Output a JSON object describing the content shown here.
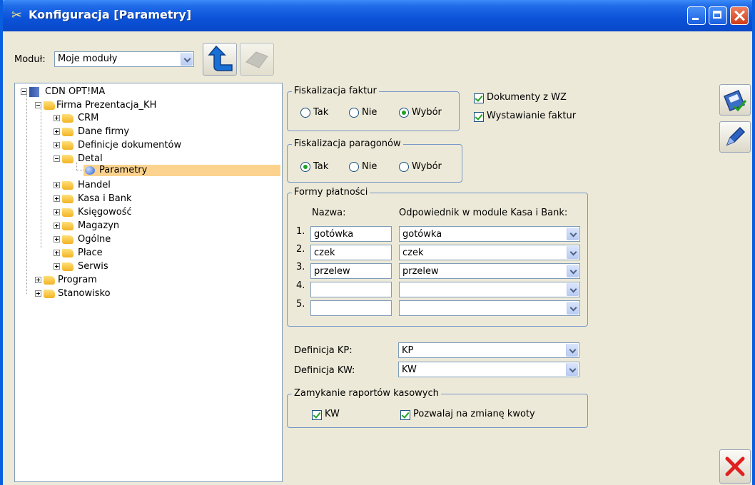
{
  "window": {
    "title": "Konfiguracja [Parametry]"
  },
  "modul": {
    "label": "Moduł:",
    "value": "Moje moduły"
  },
  "tree": {
    "root": "CDN OPT!MA",
    "firma": "Firma Prezentacja_KH",
    "firma_children": [
      "CRM",
      "Dane firmy",
      "Definicje dokumentów",
      "Detal"
    ],
    "detal_child": "Parametry",
    "firma_children_after": [
      "Handel",
      "Kasa i Bank",
      "Księgowość",
      "Magazyn",
      "Ogólne",
      "Płace",
      "Serwis"
    ],
    "top_after": [
      "Program",
      "Stanowisko"
    ]
  },
  "fisk_faktur": {
    "legend": "Fiskalizacja faktur",
    "options": [
      "Tak",
      "Nie",
      "Wybór"
    ],
    "selected": "Wybór"
  },
  "checks_top": [
    {
      "label": "Dokumenty z WZ",
      "checked": true
    },
    {
      "label": "Wystawianie faktur",
      "checked": true
    }
  ],
  "fisk_paragonow": {
    "legend": "Fiskalizacja paragonów",
    "options": [
      "Tak",
      "Nie",
      "Wybór"
    ],
    "selected": "Tak"
  },
  "formy": {
    "legend": "Formy płatności",
    "col_name": "Nazwa:",
    "col_match": "Odpowiednik w module Kasa i Bank:",
    "rows": [
      {
        "num": "1.",
        "name": "gotówka",
        "match": "gotówka"
      },
      {
        "num": "2.",
        "name": "czek",
        "match": "czek"
      },
      {
        "num": "3.",
        "name": "przelew",
        "match": "przelew"
      },
      {
        "num": "4.",
        "name": "",
        "match": ""
      },
      {
        "num": "5.",
        "name": "",
        "match": ""
      }
    ]
  },
  "definicje": {
    "kp_label": "Definicja KP:",
    "kp_value": "KP",
    "kw_label": "Definicja KW:",
    "kw_value": "KW"
  },
  "zamykanie": {
    "legend": "Zamykanie raportów kasowych",
    "kw_label": "KW",
    "kw_checked": true,
    "zmiana_label": "Pozwalaj na zmianę kwoty",
    "zmiana_checked": true
  },
  "colors": {
    "accent": "#21a121",
    "title_bar": "#0b52d8",
    "selection": "#fbd38e",
    "close_x": "#e02020"
  }
}
